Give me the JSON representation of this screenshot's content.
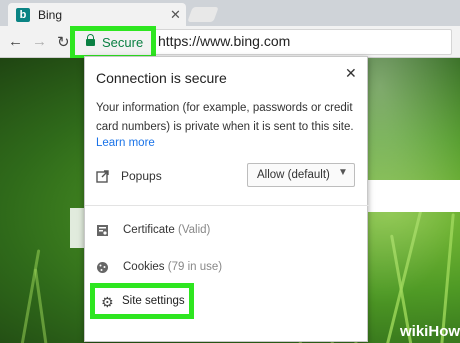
{
  "tab": {
    "title": "Bing",
    "favicon_letter": "b"
  },
  "toolbar": {
    "url": "https://www.bing.com",
    "secure_label": "Secure"
  },
  "popup": {
    "title": "Connection is secure",
    "description": "Your information (for example, passwords or credit card numbers) is private when it is sent to this site.",
    "learn_more": "Learn more",
    "popups_label": "Popups",
    "popups_value": "Allow (default)",
    "certificate_label": "Certificate",
    "certificate_status": "(Valid)",
    "cookies_label": "Cookies",
    "cookies_status": "(79 in use)",
    "site_settings_label": "Site settings"
  },
  "watermark": {
    "wiki": "wiki",
    "how": "How"
  },
  "colors": {
    "highlight": "#2ee620",
    "secure_green": "#0b8043",
    "link_blue": "#1a73e8"
  },
  "icons": [
    "bing-favicon",
    "back-arrow-icon",
    "forward-arrow-icon",
    "reload-icon",
    "lock-icon",
    "close-icon",
    "external-window-icon",
    "certificate-icon",
    "cookie-icon",
    "gear-icon",
    "dropdown-arrow-icon"
  ]
}
